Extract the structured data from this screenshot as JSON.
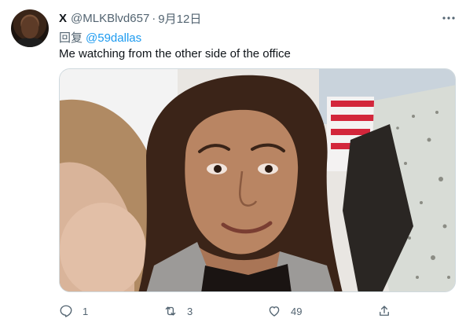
{
  "tweet": {
    "author_name": "X",
    "handle": "@MLKBlvd657",
    "separator": "·",
    "date": "9月12日",
    "reply_prefix": "回复",
    "reply_mention": "@59dallas",
    "text": "Me watching from the other side of the office",
    "media_description_icon": "photo-media",
    "actions": {
      "reply_count": "1",
      "retweet_count": "3",
      "like_count": "49"
    }
  },
  "colors": {
    "text_primary": "#0f1419",
    "text_secondary": "#536471",
    "link": "#1d9bf0",
    "border": "#cfd9de"
  },
  "icons": [
    "more-icon",
    "reply-icon",
    "retweet-icon",
    "like-icon",
    "share-icon"
  ]
}
